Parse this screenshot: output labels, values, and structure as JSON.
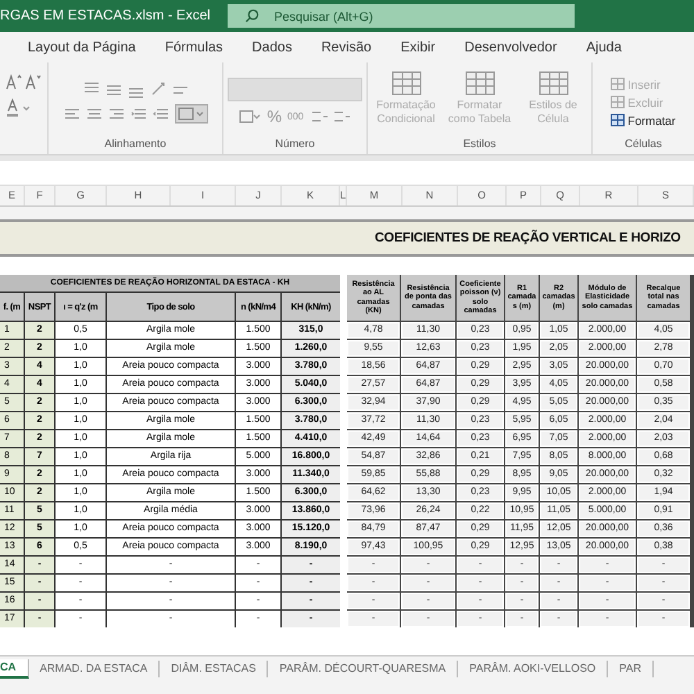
{
  "window": {
    "title": "RGAS EM ESTACAS.xlsm  -  Excel",
    "search_placeholder": "Pesquisar (Alt+G)"
  },
  "menu": [
    {
      "label": "Layout da Página",
      "selected": false
    },
    {
      "label": "Fórmulas",
      "selected": false
    },
    {
      "label": "Dados",
      "selected": false
    },
    {
      "label": "Revisão",
      "selected": false
    },
    {
      "label": "Exibir",
      "selected": false
    },
    {
      "label": "Desenvolvedor",
      "selected": false
    },
    {
      "label": "Ajuda",
      "selected": false
    }
  ],
  "ribbon": {
    "groups": [
      "Alinhamento",
      "Número",
      "Estilos",
      "Células"
    ],
    "number_symbols": [
      "%",
      "000"
    ],
    "styles": [
      {
        "label": "Formatação Condicional",
        "disabled": true
      },
      {
        "label": "Formatar como Tabela",
        "disabled": true
      },
      {
        "label": "Estilos de Célula",
        "disabled": true
      }
    ],
    "cells": [
      {
        "label": "Inserir",
        "disabled": true
      },
      {
        "label": "Excluir",
        "disabled": true
      },
      {
        "label": "Formatar",
        "disabled": false
      }
    ]
  },
  "column_headers": [
    "E",
    "F",
    "G",
    "H",
    "I",
    "J",
    "K",
    "L",
    "M",
    "N",
    "O",
    "P",
    "Q",
    "R",
    "S"
  ],
  "banner": {
    "title": "COEFICIENTES DE REAÇÃO VERTICAL E HORIZO"
  },
  "left_table": {
    "title": "COEFICIENTES DE REAÇÃO HORIZONTAL DA ESTACA - KH",
    "columns": [
      "f.  (m",
      "NSPT",
      "ı = q'z (m",
      "Tipo de solo",
      "n (kN/m4",
      "KH (kN/m)"
    ],
    "rows": [
      [
        "1",
        "2",
        "0,5",
        "Argila mole",
        "1.500",
        "315,0"
      ],
      [
        "2",
        "2",
        "1,0",
        "Argila mole",
        "1.500",
        "1.260,0"
      ],
      [
        "3",
        "4",
        "1,0",
        "Areia pouco compacta",
        "3.000",
        "3.780,0"
      ],
      [
        "4",
        "4",
        "1,0",
        "Areia pouco compacta",
        "3.000",
        "5.040,0"
      ],
      [
        "5",
        "2",
        "1,0",
        "Areia pouco compacta",
        "3.000",
        "6.300,0"
      ],
      [
        "6",
        "2",
        "1,0",
        "Argila mole",
        "1.500",
        "3.780,0"
      ],
      [
        "7",
        "2",
        "1,0",
        "Argila mole",
        "1.500",
        "4.410,0"
      ],
      [
        "8",
        "7",
        "1,0",
        "Argila rija",
        "5.000",
        "16.800,0"
      ],
      [
        "9",
        "2",
        "1,0",
        "Areia pouco compacta",
        "3.000",
        "11.340,0"
      ],
      [
        "10",
        "2",
        "1,0",
        "Argila mole",
        "1.500",
        "6.300,0"
      ],
      [
        "11",
        "5",
        "1,0",
        "Argila média",
        "3.000",
        "13.860,0"
      ],
      [
        "12",
        "5",
        "1,0",
        "Areia pouco compacta",
        "3.000",
        "15.120,0"
      ],
      [
        "13",
        "6",
        "0,5",
        "Areia pouco compacta",
        "3.000",
        "8.190,0"
      ],
      [
        "14",
        "-",
        "-",
        "-",
        "-",
        "-"
      ],
      [
        "15",
        "-",
        "-",
        "-",
        "-",
        "-"
      ],
      [
        "16",
        "-",
        "-",
        "-",
        "-",
        "-"
      ],
      [
        "17",
        "-",
        "-",
        "-",
        "-",
        "-"
      ]
    ]
  },
  "right_table": {
    "columns": [
      "Resistência ao AL camadas (KN)",
      "Resistência de ponta das camadas",
      "Coeficiente poisson (ν) solo camadas",
      "R1 camadas (m)",
      "R2 camadas (m)",
      "Módulo de Elasticidade solo camadas",
      "Recalque total nas camadas"
    ],
    "rows": [
      [
        "4,78",
        "11,30",
        "0,23",
        "0,95",
        "1,05",
        "2.000,00",
        "4,05"
      ],
      [
        "9,55",
        "12,63",
        "0,23",
        "1,95",
        "2,05",
        "2.000,00",
        "2,78"
      ],
      [
        "18,56",
        "64,87",
        "0,29",
        "2,95",
        "3,05",
        "20.000,00",
        "0,70"
      ],
      [
        "27,57",
        "64,87",
        "0,29",
        "3,95",
        "4,05",
        "20.000,00",
        "0,58"
      ],
      [
        "32,94",
        "37,90",
        "0,29",
        "4,95",
        "5,05",
        "20.000,00",
        "0,35"
      ],
      [
        "37,72",
        "11,30",
        "0,23",
        "5,95",
        "6,05",
        "2.000,00",
        "2,04"
      ],
      [
        "42,49",
        "14,64",
        "0,23",
        "6,95",
        "7,05",
        "2.000,00",
        "2,03"
      ],
      [
        "54,87",
        "32,86",
        "0,21",
        "7,95",
        "8,05",
        "8.000,00",
        "0,68"
      ],
      [
        "59,85",
        "55,88",
        "0,29",
        "8,95",
        "9,05",
        "20.000,00",
        "0,32"
      ],
      [
        "64,62",
        "13,30",
        "0,23",
        "9,95",
        "10,05",
        "2.000,00",
        "1,94"
      ],
      [
        "73,96",
        "26,24",
        "0,22",
        "10,95",
        "11,05",
        "5.000,00",
        "0,91"
      ],
      [
        "84,79",
        "87,47",
        "0,29",
        "11,95",
        "12,05",
        "20.000,00",
        "0,36"
      ],
      [
        "97,43",
        "100,95",
        "0,29",
        "12,95",
        "13,05",
        "20.000,00",
        "0,38"
      ],
      [
        "-",
        "-",
        "-",
        "-",
        "-",
        "-",
        "-"
      ],
      [
        "-",
        "-",
        "-",
        "-",
        "-",
        "-",
        "-"
      ],
      [
        "-",
        "-",
        "-",
        "-",
        "-",
        "-",
        "-"
      ],
      [
        "-",
        "-",
        "-",
        "-",
        "-",
        "-",
        "-"
      ]
    ]
  },
  "sheet_tabs": [
    {
      "label": "CA",
      "selected": true
    },
    {
      "label": "ARMAD. DA ESTACA",
      "selected": false
    },
    {
      "label": "DIÂM. ESTACAS",
      "selected": false
    },
    {
      "label": "PARÂM. DÉCOURT-QUARESMA",
      "selected": false
    },
    {
      "label": "PARÂM. AOKI-VELLOSO",
      "selected": false
    },
    {
      "label": "PAR",
      "selected": false
    }
  ]
}
